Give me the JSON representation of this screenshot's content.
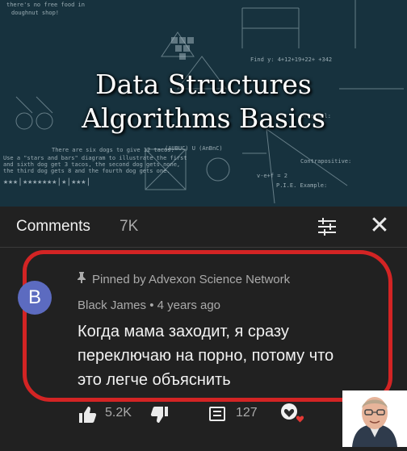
{
  "video": {
    "title_line1": "Data Structures",
    "title_line2": "Algorithms Basics",
    "chalk_notes": [
      "there's no free food in",
      "doughnut shop!",
      "Find y: 4+12+19+22+ +342",
      "Original:",
      "Contrapositive:",
      "There are six dogs to give 12 tacos.",
      "Use a \"stars and bars\" diagram to illustrate the first",
      "and sixth dog get 3 tacos, the second dog gets none,",
      "the third dog gets 8 and the fourth dog gets one.",
      "P.I.E. Example:",
      "(AUBUC) U (AnBnC)",
      "v-e+f = 2",
      "★★★|★★★★★★★|★|★★★|"
    ]
  },
  "header": {
    "title": "Comments",
    "count": "7K",
    "sort_icon": "sort-icon",
    "close_icon": "close-icon",
    "close_glyph": "✕"
  },
  "comment": {
    "avatar_letter": "B",
    "avatar_color": "#5c6bc0",
    "pinned_text": "Pinned by Advexon Science Network",
    "pin_icon": "pin-icon",
    "author": "Black James",
    "separator": "•",
    "timestamp": "4 years ago",
    "text": "Когда мама заходит, я сразу переключаю на порно, потому что это легче объяснить",
    "likes": "5.2K",
    "replies": "127",
    "highlight_color": "#d32424"
  }
}
